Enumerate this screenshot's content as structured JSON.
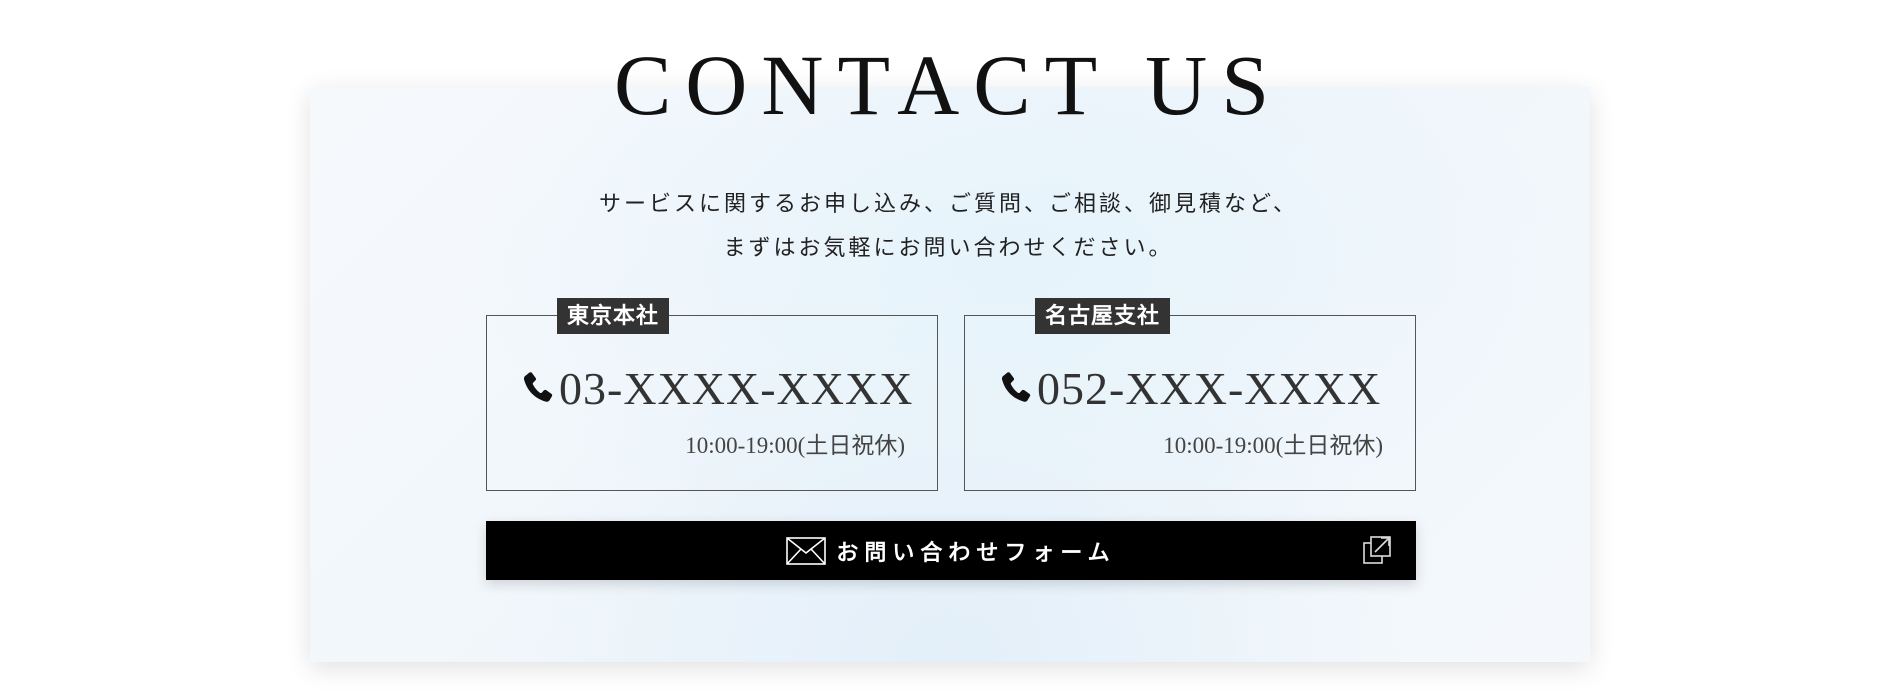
{
  "section": {
    "title": "CONTACT US",
    "intro_line1": "サービスに関するお申し込み、ご質問、ご相談、御見積など、",
    "intro_line2": "まずはお気軽にお問い合わせください。"
  },
  "offices": [
    {
      "name": "東京本社",
      "phone": "03-XXXX-XXXX",
      "hours": "10:00-19:00(土日祝休)",
      "icon": "phone-icon"
    },
    {
      "name": "名古屋支社",
      "phone": "052-XXX-XXXX",
      "hours": "10:00-19:00(土日祝休)",
      "icon": "phone-icon"
    }
  ],
  "form_button": {
    "label": "お問い合わせフォーム",
    "icon": "mail-icon",
    "trailing_icon": "external-link-icon"
  },
  "colors": {
    "tag_bg": "#333333",
    "button_bg": "#000000",
    "text": "#222222"
  }
}
